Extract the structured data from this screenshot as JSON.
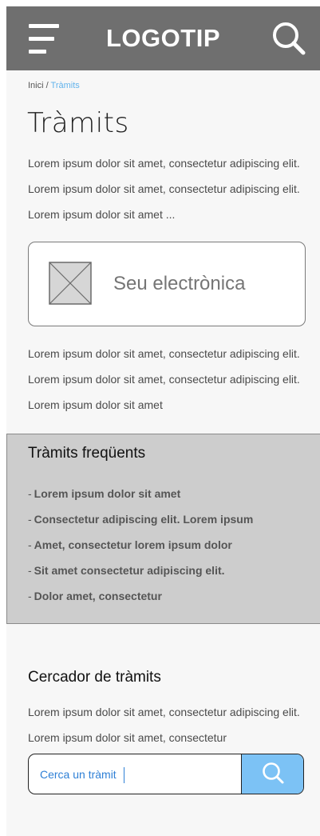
{
  "header": {
    "logo": "LOGOTIP",
    "menu_icon": "hamburger-menu-icon",
    "search_icon": "search-icon",
    "background": "#6f6f6f"
  },
  "breadcrumb": {
    "home": "Inici",
    "separator": " / ",
    "current": "Tràmits"
  },
  "main": {
    "title": "Tràmits",
    "intro": "Lorem ipsum dolor sit amet, consectetur adipiscing elit. Lorem ipsum dolor sit amet, consectetur adipiscing elit. Lorem ipsum dolor sit amet ...",
    "seu_card": {
      "label": "Seu electrònica",
      "image_icon": "image-placeholder-icon"
    },
    "description": "Lorem ipsum dolor sit amet, consectetur adipiscing elit. Lorem ipsum dolor sit amet, consectetur adipiscing elit. Lorem ipsum dolor sit amet"
  },
  "frequent": {
    "title": "Tràmits freqüents",
    "items": [
      "Lorem ipsum dolor sit amet",
      "Consectetur adipiscing elit. Lorem ipsum",
      "Amet, consectetur lorem ipsum dolor",
      "Sit amet consectetur adipiscing elit.",
      "Dolor amet, consectetur"
    ],
    "background": "#cdcdcd"
  },
  "search": {
    "title": "Cercador de tràmits",
    "description": "Lorem ipsum dolor sit amet, consectetur adipiscing elit. Lorem ipsum dolor sit amet, consectetur",
    "value": "Cerca un tràmit",
    "button_icon": "search-icon",
    "accent": "#7cc2f5"
  }
}
